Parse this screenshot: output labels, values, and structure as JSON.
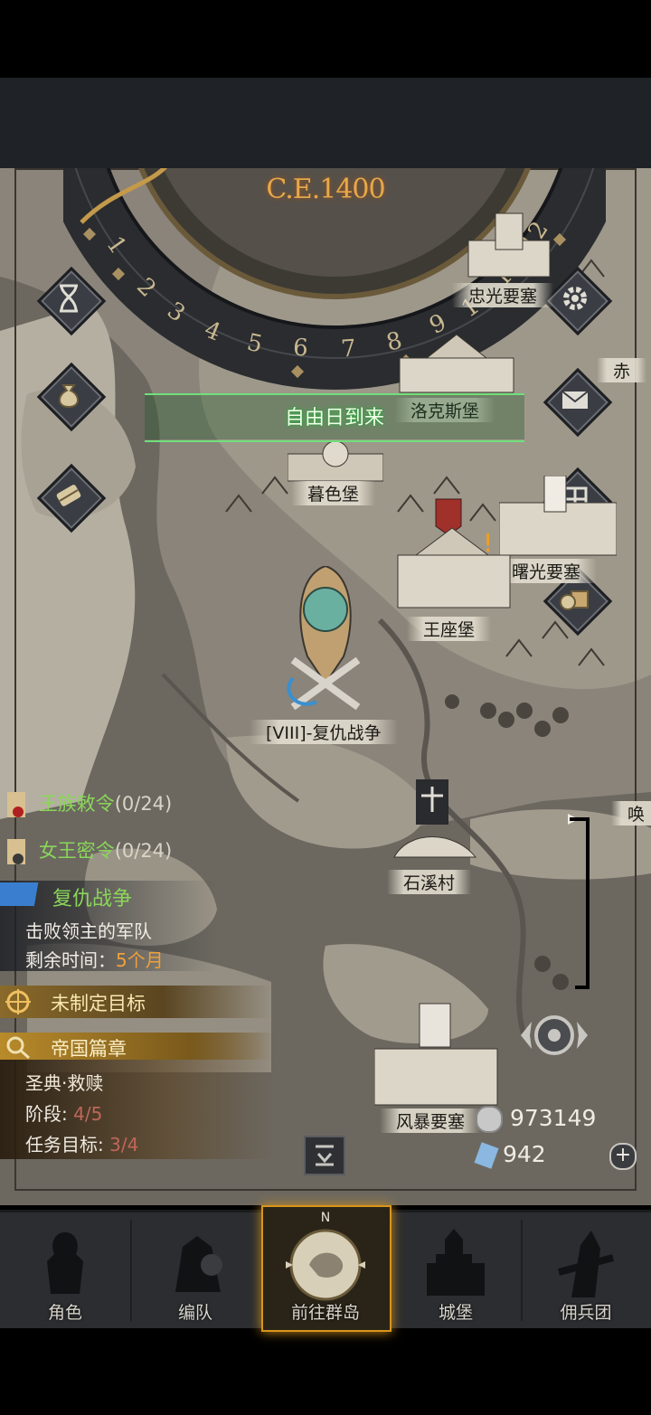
{
  "calendar": {
    "era": "C.E.1400",
    "months": [
      "1",
      "2",
      "3",
      "4",
      "5",
      "6",
      "7",
      "8",
      "9",
      "10",
      "11",
      "12"
    ]
  },
  "banner": {
    "text": "自由日到来"
  },
  "locations": [
    {
      "name": "忠光要塞"
    },
    {
      "name": "洛克斯堡"
    },
    {
      "name": "暮色堡"
    },
    {
      "name": "曙光要塞"
    },
    {
      "name": "王座堡"
    },
    {
      "name": "[VIII]-复仇战争"
    },
    {
      "name": "石溪村"
    },
    {
      "name": "风暴要塞"
    },
    {
      "name": "赤"
    },
    {
      "name": "唤"
    }
  ],
  "quests": {
    "royal_decree": {
      "title": "王族敕令",
      "progress": "(0/24)"
    },
    "queen_order": {
      "title": "女王密令",
      "progress": "(0/24)"
    },
    "revenge_war": {
      "title": "复仇战争",
      "desc": "击败领主的军队",
      "time_label": "剩余时间：",
      "time_value": "5个月"
    },
    "goal": {
      "title": "未制定目标"
    },
    "empire": {
      "title": "帝国篇章",
      "subtitle": "圣典·救赎",
      "stage_label": "阶段: ",
      "stage_value": "4/5",
      "task_label": "任务目标: ",
      "task_value": "3/4"
    }
  },
  "resources": {
    "silver": "973149",
    "crystal": "942"
  },
  "nav": {
    "items": [
      {
        "label": "角色"
      },
      {
        "label": "编队"
      },
      {
        "label": "前往群岛"
      },
      {
        "label": "城堡"
      },
      {
        "label": "佣兵团"
      }
    ],
    "compass_letter": "N"
  },
  "colors": {
    "accent_gold": "#d8951c",
    "banner_green": "#36c04a",
    "quest_green": "#8ad65a"
  }
}
